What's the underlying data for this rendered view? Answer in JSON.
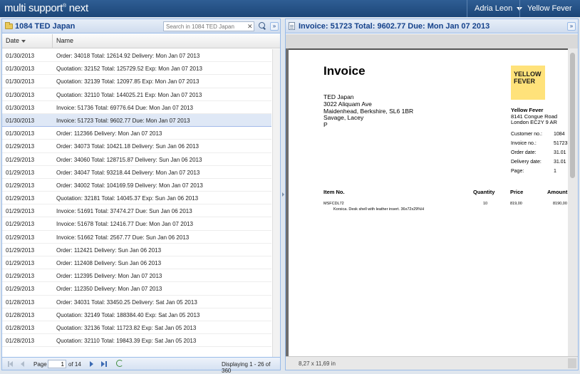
{
  "app": {
    "logo_text": "multi support",
    "logo_sup": "®",
    "logo_suffix": " next",
    "user_menu": "Adria Leon",
    "company_menu": "Yellow Fever"
  },
  "left_panel": {
    "title": "1084 TED Japan",
    "search_placeholder": "Search in 1084 TED Japan",
    "columns": {
      "date": "Date",
      "name": "Name"
    },
    "rows": [
      {
        "date": "01/30/2013",
        "name": "Order: 34018 Total: 12614.92 Delivery: Mon Jan 07 2013"
      },
      {
        "date": "01/30/2013",
        "name": "Quotation: 32152 Total: 125729.52 Exp: Mon Jan 07 2013"
      },
      {
        "date": "01/30/2013",
        "name": "Quotation: 32139 Total: 12097.85 Exp: Mon Jan 07 2013"
      },
      {
        "date": "01/30/2013",
        "name": "Quotation: 32110 Total: 144025.21 Exp: Mon Jan 07 2013"
      },
      {
        "date": "01/30/2013",
        "name": "Invoice: 51736 Total: 69776.64 Due: Mon Jan 07 2013"
      },
      {
        "date": "01/30/2013",
        "name": "Invoice: 51723 Total: 9602.77 Due: Mon Jan 07 2013"
      },
      {
        "date": "01/30/2013",
        "name": "Order: 112366 Delivery: Mon Jan 07 2013"
      },
      {
        "date": "01/29/2013",
        "name": "Order: 34073 Total: 10421.18 Delivery: Sun Jan 06 2013"
      },
      {
        "date": "01/29/2013",
        "name": "Order: 34060 Total: 128715.87 Delivery: Sun Jan 06 2013"
      },
      {
        "date": "01/29/2013",
        "name": "Order: 34047 Total: 93218.44 Delivery: Mon Jan 07 2013"
      },
      {
        "date": "01/29/2013",
        "name": "Order: 34002 Total: 104169.59 Delivery: Mon Jan 07 2013"
      },
      {
        "date": "01/29/2013",
        "name": "Quotation: 32181 Total: 14045.37 Exp: Sun Jan 06 2013"
      },
      {
        "date": "01/29/2013",
        "name": "Invoice: 51691 Total: 37474.27 Due: Sun Jan 06 2013"
      },
      {
        "date": "01/29/2013",
        "name": "Invoice: 51678 Total: 12416.77 Due: Mon Jan 07 2013"
      },
      {
        "date": "01/29/2013",
        "name": "Invoice: 51662 Total: 2567.77 Due: Sun Jan 06 2013"
      },
      {
        "date": "01/29/2013",
        "name": "Order: 112421 Delivery: Sun Jan 06 2013"
      },
      {
        "date": "01/29/2013",
        "name": "Order: 112408 Delivery: Sun Jan 06 2013"
      },
      {
        "date": "01/29/2013",
        "name": "Order: 112395 Delivery: Mon Jan 07 2013"
      },
      {
        "date": "01/29/2013",
        "name": "Order: 112350 Delivery: Mon Jan 07 2013"
      },
      {
        "date": "01/28/2013",
        "name": "Order: 34031 Total: 33450.25 Delivery: Sat Jan 05 2013"
      },
      {
        "date": "01/28/2013",
        "name": "Quotation: 32149 Total: 188384.40 Exp: Sat Jan 05 2013"
      },
      {
        "date": "01/28/2013",
        "name": "Quotation: 32136 Total: 11723.82 Exp: Sat Jan 05 2013"
      },
      {
        "date": "01/28/2013",
        "name": "Quotation: 32110 Total: 19843.39 Exp: Sat Jan 05 2013"
      }
    ],
    "selected_index": 5,
    "paging": {
      "page_label": "Page",
      "page_value": "1",
      "of_label": "of 14",
      "display_text": "Displaying 1 - 26 of 360"
    }
  },
  "right_panel": {
    "title": "Invoice: 51723 Total: 9602.77 Due: Mon Jan 07 2013",
    "invoice": {
      "heading": "Invoice",
      "customer_address": [
        "TED Japan",
        "3022 Aliquam Ave",
        "Maidenhead, Berkshire, SL6 1BR",
        "Savage, Lacey",
        "P"
      ],
      "logo_line1": "YELLOW",
      "logo_line2": "FEVER",
      "vendor_name": "Yellow Fever",
      "vendor_address": [
        "8141  Congue Road",
        "London EC2Y 9 AR"
      ],
      "meta": [
        {
          "label": "Customer no.:",
          "value": "1084"
        },
        {
          "label": "Invoice no.:",
          "value": "51723"
        },
        {
          "label": "Order date:",
          "value": "31.01"
        },
        {
          "label": "Delivery date:",
          "value": "31.01"
        },
        {
          "label": "Page:",
          "value": "1"
        }
      ],
      "columns": {
        "item": "Item No.",
        "quantity": "Quantity",
        "price": "Price",
        "amount": "Amount"
      },
      "item": {
        "code": "MSFCDL72",
        "description": "Korsica. Desk shell with leather insert. 36x72x29%H",
        "quantity": "10",
        "price": "819,00",
        "amount": "8190,00"
      }
    },
    "page_size": "8,27 x 11,69 in"
  }
}
